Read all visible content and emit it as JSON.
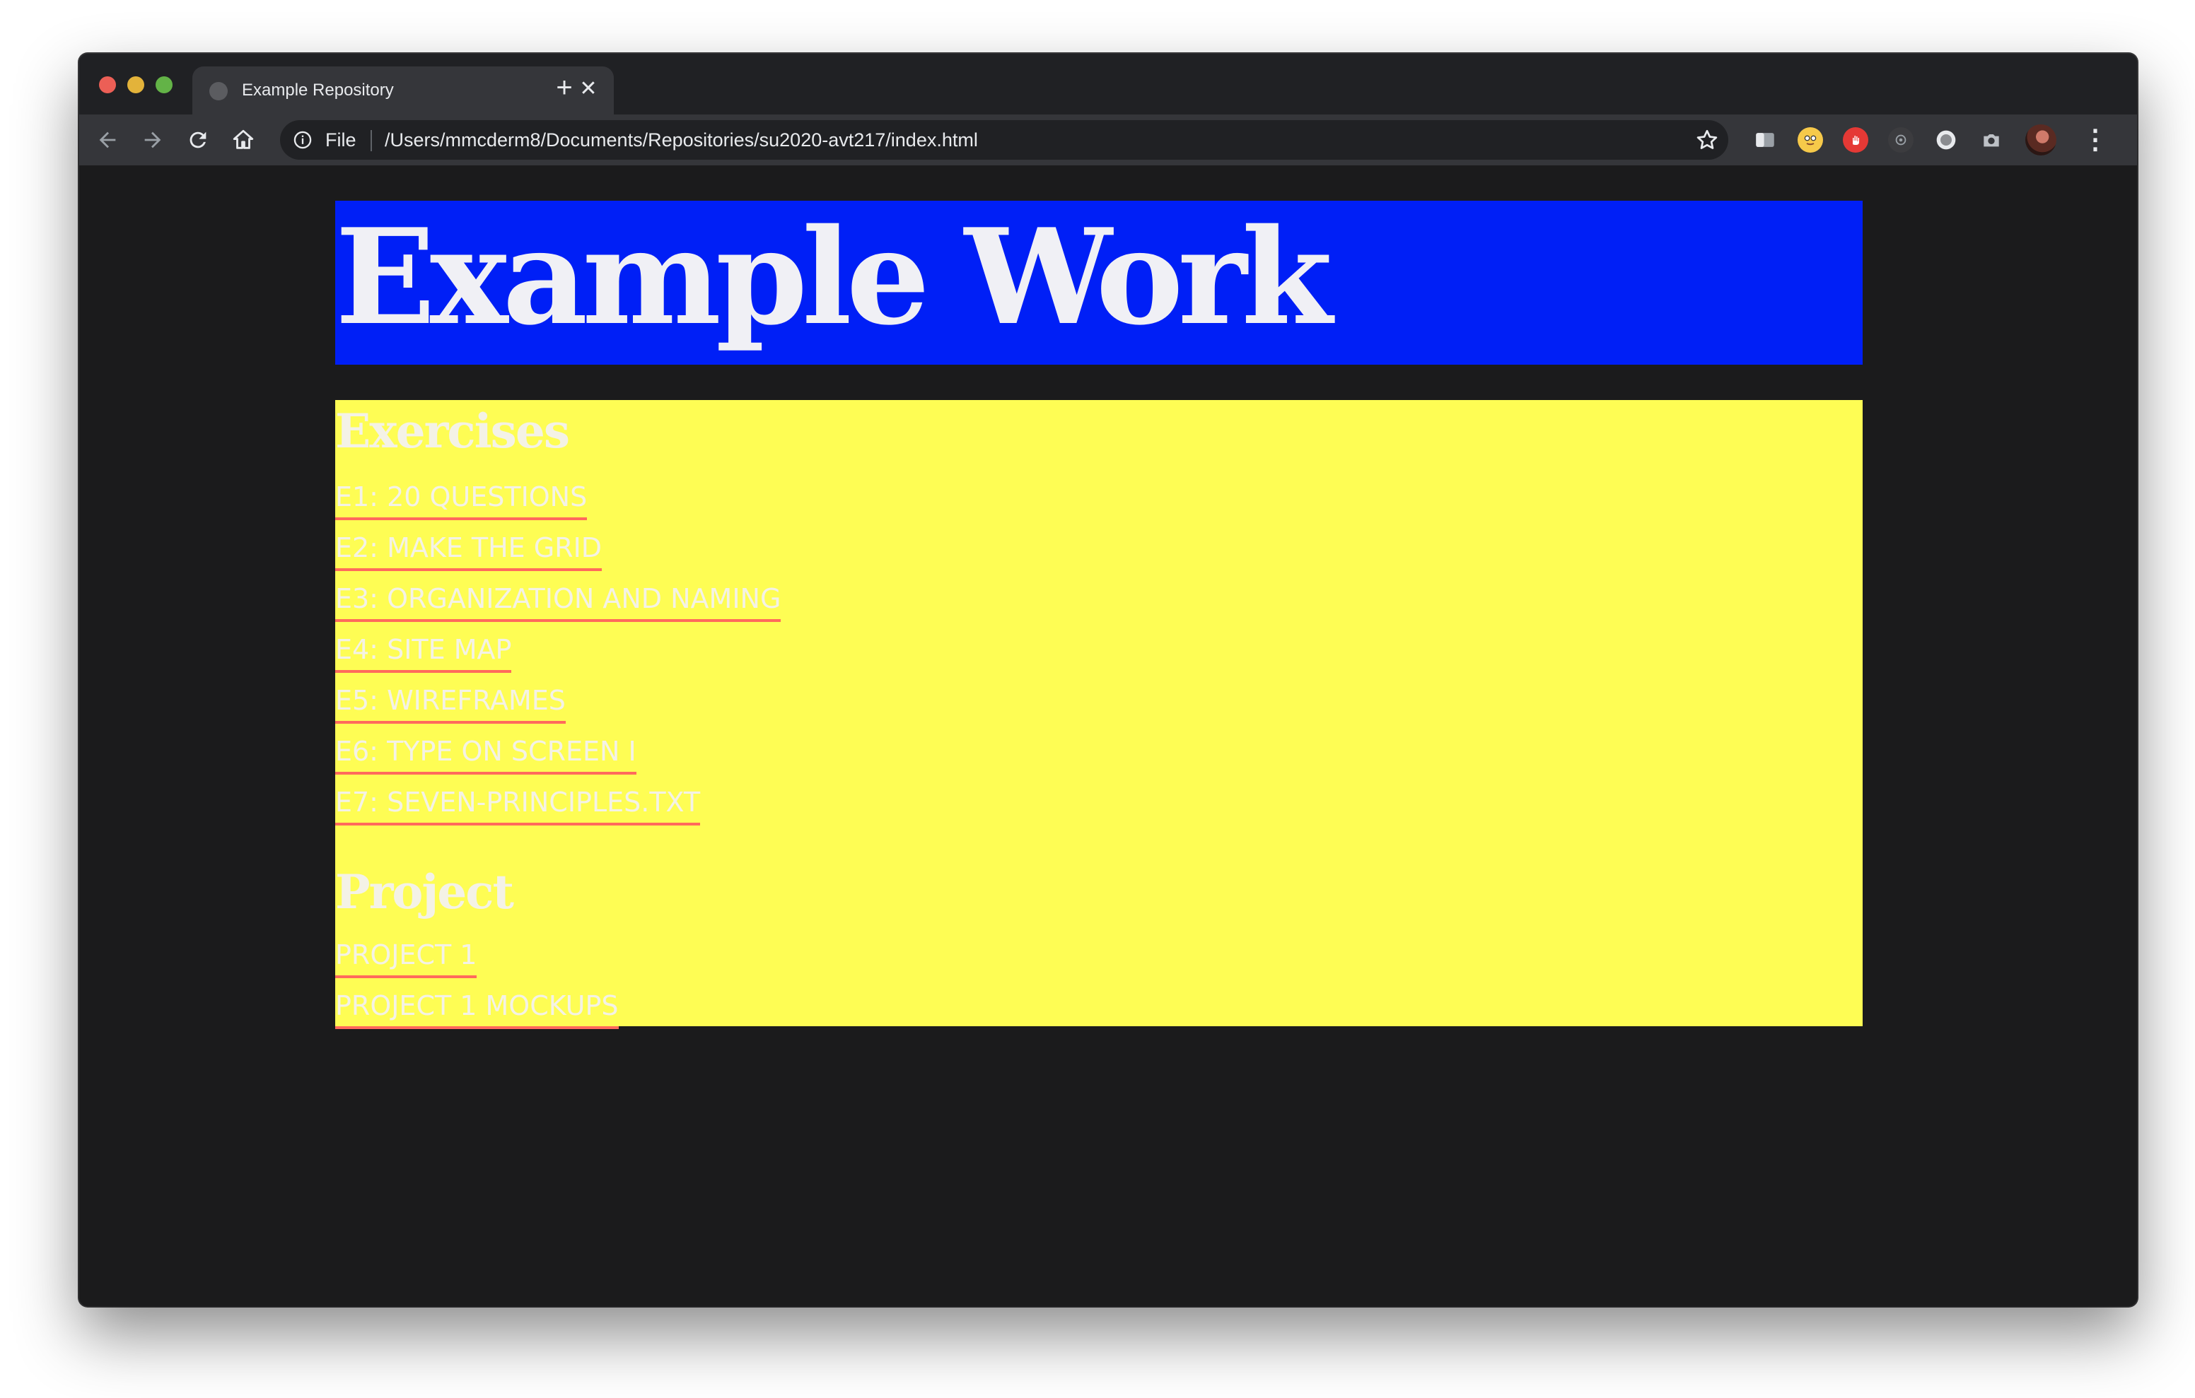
{
  "browser": {
    "tab": {
      "title": "Example Repository",
      "close_glyph": "✕"
    },
    "new_tab_glyph": "+",
    "toolbar": {
      "back_icon": "arrow-left-icon",
      "forward_icon": "arrow-right-icon",
      "reload_icon": "reload-icon",
      "home_icon": "home-icon"
    },
    "omnibox": {
      "scheme": "File",
      "url": "/Users/mmcderm8/Documents/Repositories/su2020-avt217/index.html"
    },
    "extensions": [
      "extension-puzzle-icon",
      "emoji-face-icon",
      "stop-hand-icon",
      "circle-extension-icon",
      "record-icon",
      "camera-icon"
    ],
    "menu_glyph": "⋮"
  },
  "page": {
    "header": {
      "title": "Example Work",
      "background": "#001ff6"
    },
    "content_background": "#fefd54",
    "link_underline_color": "#ff6a5c",
    "exercises": {
      "heading": "Exercises",
      "links": [
        "E1: 20 QUESTIONS",
        "E2: MAKE THE GRID",
        "E3: ORGANIZATION AND NAMING",
        "E4: SITE MAP",
        "E5: WIREFRAMES",
        "E6: TYPE ON SCREEN I",
        "E7: SEVEN-PRINCIPLES.TXT"
      ]
    },
    "project": {
      "heading": "Project",
      "links": [
        "PROJECT 1",
        "PROJECT 1 MOCKUPS"
      ]
    }
  }
}
